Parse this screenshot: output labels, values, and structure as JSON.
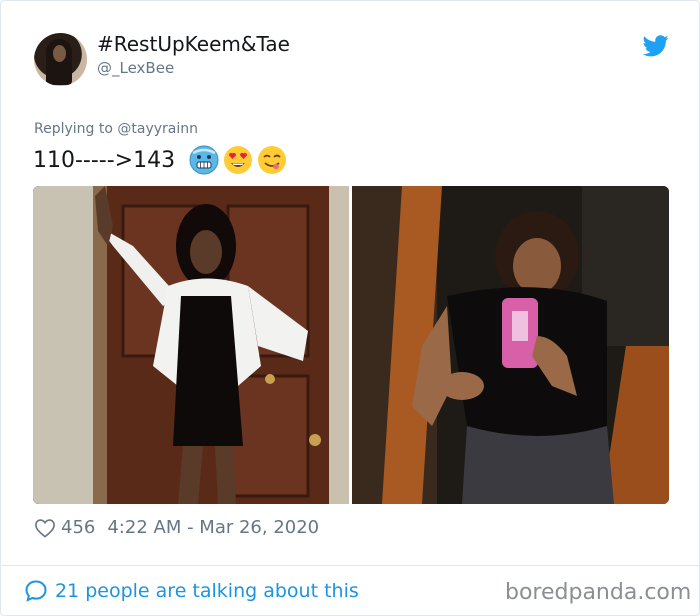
{
  "tweet": {
    "display_name": "#RestUpKeem&Tae",
    "handle": "@_LexBee",
    "replying_prefix": "Replying to ",
    "replying_to": "@tayyrainn",
    "text": "110----->143",
    "emojis": [
      "cold-face-emoji",
      "heart-eyes-emoji",
      "yum-face-emoji"
    ],
    "images": [
      {
        "description_icon": "photo-woman-black-dress-doorway"
      },
      {
        "description_icon": "photo-woman-mirror-selfie"
      }
    ],
    "like_count": "456",
    "timestamp": "4:22 AM - Mar 26, 2020",
    "talking_text": "21 people are talking about this"
  },
  "watermark": "boredpanda.com",
  "colors": {
    "twitter_blue": "#1da1f2",
    "link_blue": "#1b95e0",
    "meta_gray": "#657786",
    "text_dark": "#14171a"
  }
}
